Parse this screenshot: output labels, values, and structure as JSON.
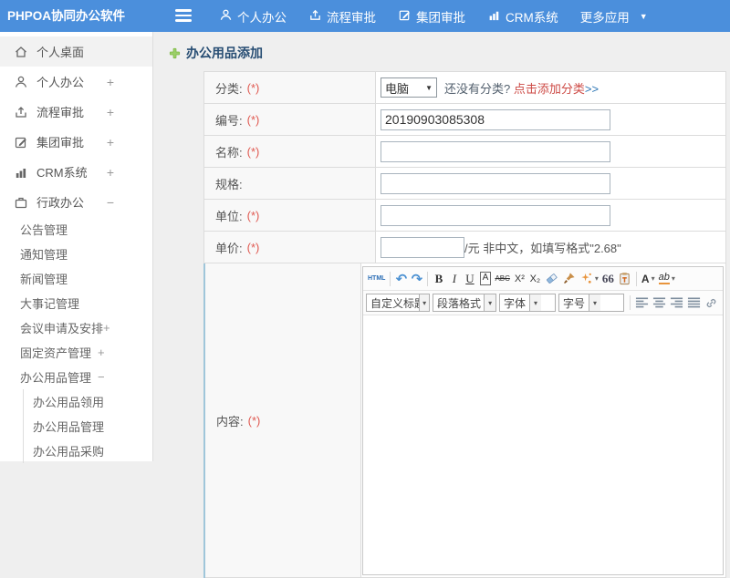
{
  "colors": {
    "topbar_blue": "#4b8fdc",
    "title_navy": "#274d73",
    "required_red": "#e05a52",
    "link_red": "#cd4a45",
    "link_blue": "#2f77b5",
    "content_row_accent": "#9fc6da"
  },
  "icons": {
    "caret_down": "▼",
    "combo_caret": "▾",
    "undo": "↶",
    "redo": "↷"
  },
  "topbar": {
    "brand": "PHPOA协同办公软件",
    "items": [
      {
        "label": "个人办公",
        "icon": "user-icon"
      },
      {
        "label": "流程审批",
        "icon": "workflow-icon"
      },
      {
        "label": "集团审批",
        "icon": "edit-square-icon"
      },
      {
        "label": "CRM系统",
        "icon": "bar-chart-icon"
      },
      {
        "label": "更多应用",
        "icon": "caret-down-icon"
      }
    ]
  },
  "sidebar": {
    "items": [
      {
        "label": "个人桌面",
        "expand": ""
      },
      {
        "label": "个人办公",
        "expand": "+"
      },
      {
        "label": "流程审批",
        "expand": "+"
      },
      {
        "label": "集团审批",
        "expand": "+"
      },
      {
        "label": "CRM系统",
        "expand": "+"
      },
      {
        "label": "行政办公",
        "expand": "−"
      }
    ],
    "submenu": [
      {
        "label": "公告管理",
        "expand": ""
      },
      {
        "label": "通知管理",
        "expand": ""
      },
      {
        "label": "新闻管理",
        "expand": ""
      },
      {
        "label": "大事记管理",
        "expand": ""
      },
      {
        "label": "会议申请及安排",
        "expand": "+"
      },
      {
        "label": "固定资产管理",
        "expand": "+"
      },
      {
        "label": "办公用品管理",
        "expand": "−"
      }
    ],
    "subsubmenu": [
      {
        "label": "办公用品领用"
      },
      {
        "label": "办公用品管理"
      },
      {
        "label": "办公用品采购"
      }
    ]
  },
  "main": {
    "title": "办公用品添加",
    "form": {
      "category": {
        "label": "分类:",
        "required": "(*)",
        "selected": "电脑",
        "hint_question": "还没有分类?",
        "hint_link": "点击添加分类",
        "hint_arrows": ">>"
      },
      "code": {
        "label": "编号:",
        "required": "(*)",
        "value": "20190903085308"
      },
      "name": {
        "label": "名称:",
        "required": "(*)",
        "value": ""
      },
      "spec": {
        "label": "规格:",
        "required": "",
        "value": ""
      },
      "unit": {
        "label": "单位:",
        "required": "(*)",
        "value": ""
      },
      "price": {
        "label": "单价:",
        "required": "(*)",
        "value": "",
        "hint": "/元 非中文，如填写格式\"2.68\""
      },
      "content": {
        "label": "内容:",
        "required": "(*)"
      }
    }
  },
  "editor": {
    "html_button": "HTML",
    "bold": "B",
    "italic": "I",
    "underline": "U",
    "char_border": "A",
    "strike": "ABC",
    "superscript": "X²",
    "subscript": "X₂",
    "quote": "66",
    "font_color": "A",
    "highlight": "ab",
    "dropdowns": [
      {
        "label": "自定义标题"
      },
      {
        "label": "段落格式"
      },
      {
        "label": "字体"
      },
      {
        "label": "字号"
      }
    ]
  }
}
